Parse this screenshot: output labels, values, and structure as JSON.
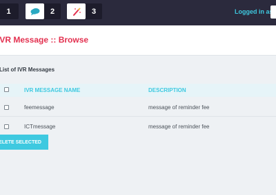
{
  "topbar": {
    "badges": [
      {
        "icon": "number-badge",
        "count": "1"
      },
      {
        "icon": "comment-icon",
        "count": "2"
      },
      {
        "icon": "magic-wand-icon",
        "count": "3"
      }
    ],
    "login_label": "Logged in as :"
  },
  "page": {
    "title": "IVR Message :: Browse"
  },
  "list": {
    "title": "List of IVR Messages",
    "columns": [
      "IVR MESSAGE NAME",
      "DESCRIPTION"
    ],
    "rows": [
      {
        "name": "feemessage",
        "description": "message of reminder fee"
      },
      {
        "name": "ICTmessage",
        "description": "message of reminder fee"
      }
    ],
    "delete_button": "DELETE SELECTED"
  },
  "colors": {
    "topbar": "#2b2a3d",
    "accent": "#3ec9e0",
    "title": "#e3304f"
  }
}
